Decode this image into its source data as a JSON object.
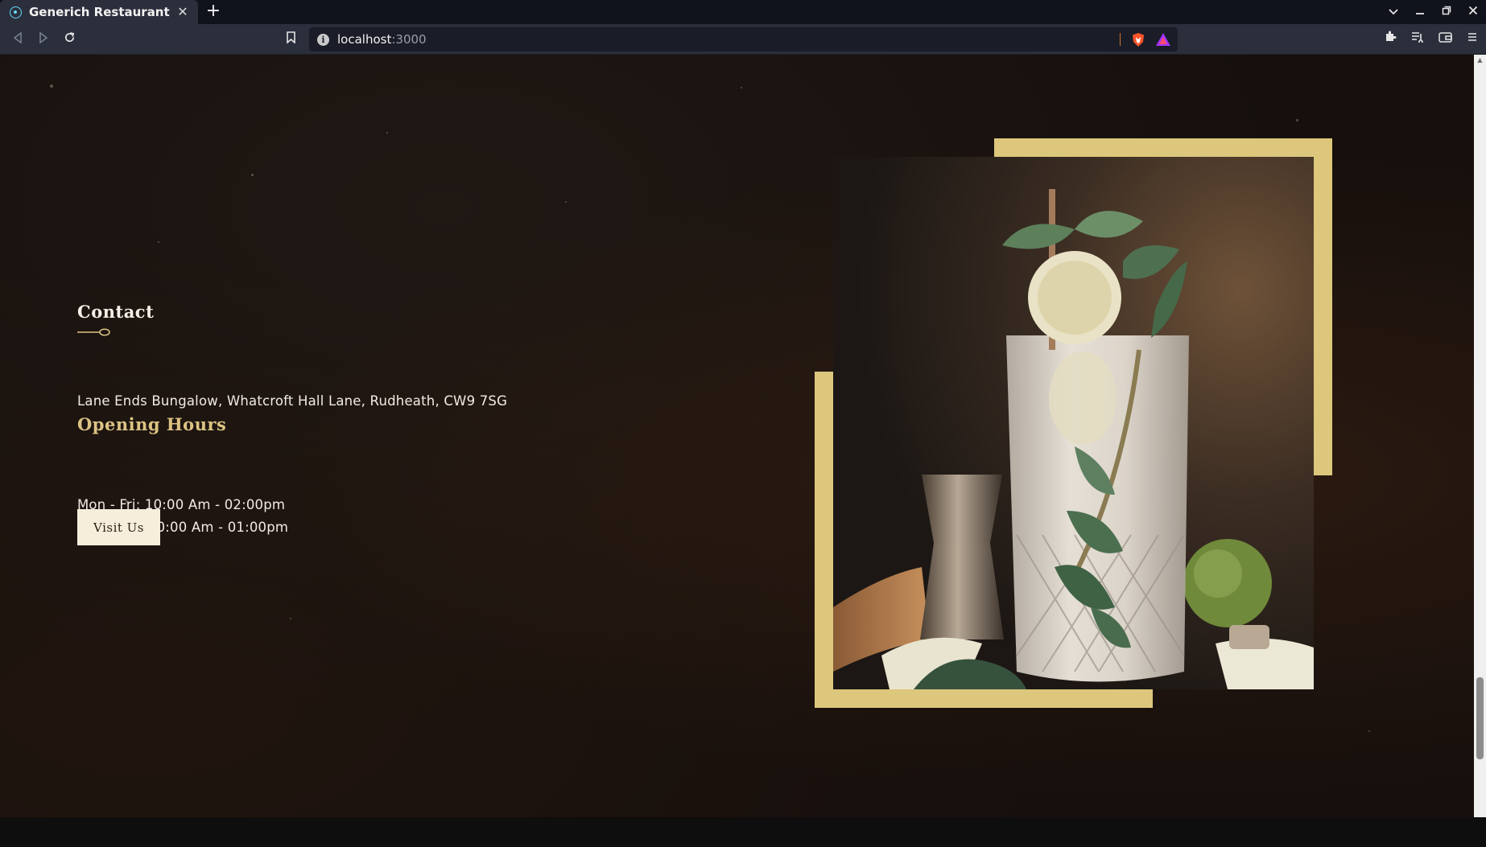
{
  "browser": {
    "tab_title": "Generich Restaurant",
    "url_host": "localhost",
    "url_port": ":3000",
    "tab_close_glyph": "✕",
    "new_tab_glyph": "+",
    "icons": [
      "react-favicon-icon",
      "back-icon",
      "forward-icon",
      "reload-icon",
      "bookmark-icon",
      "site-info-icon",
      "brave-shield-icon",
      "brave-rewards-icon",
      "extensions-icon",
      "reading-list-icon",
      "wallet-icon",
      "menu-icon",
      "tab-search-icon",
      "minimize-icon",
      "maximize-icon",
      "close-window-icon"
    ]
  },
  "contact": {
    "title": "Contact",
    "address": "Lane Ends Bungalow, Whatcroft Hall Lane, Rudheath, CW9 7SG",
    "hours_heading": "Opening Hours",
    "hours": [
      "Mon - Fri: 10:00 Am - 02:00pm",
      "Sat - Sun: 10:00 Am - 01:00pm"
    ],
    "button_label": "Visit Us"
  },
  "colors": {
    "accent_gold": "#dcc77c",
    "heading_gold": "#dcc383",
    "button_bg": "#f6eedb",
    "page_bg": "#160f0c"
  }
}
